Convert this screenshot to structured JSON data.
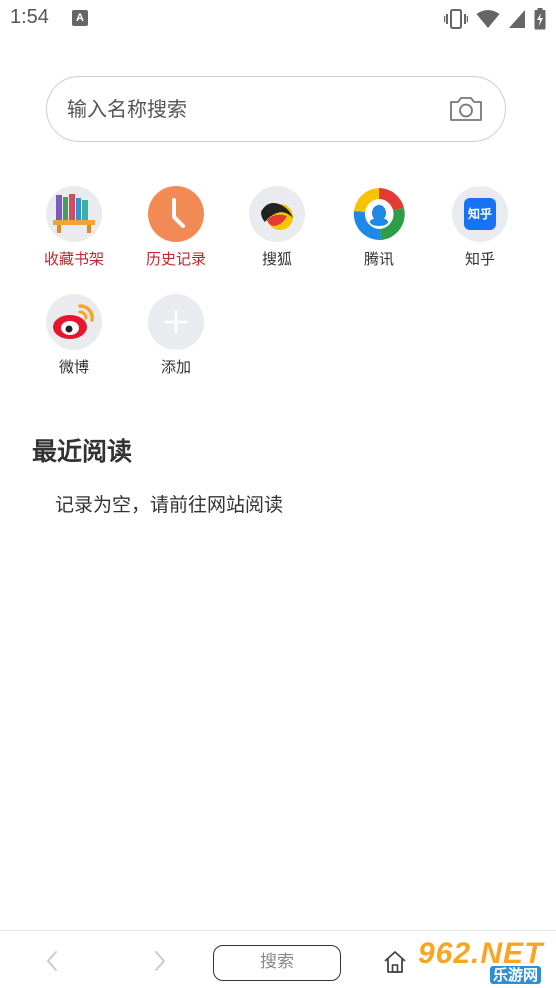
{
  "status_bar": {
    "time": "1:54",
    "notification_icon": "A",
    "icons": [
      "vibrate-icon",
      "wifi-icon",
      "signal-icon",
      "battery-charging-icon"
    ]
  },
  "search": {
    "placeholder": "输入名称搜索",
    "value": "",
    "camera_icon": "camera-icon"
  },
  "shortcuts": [
    {
      "label": "收藏书架",
      "icon": "bookshelf-icon",
      "label_color": "#c0262c"
    },
    {
      "label": "历史记录",
      "icon": "clock-icon",
      "label_color": "#c0262c",
      "bg_color": "#f28a56"
    },
    {
      "label": "搜狐",
      "icon": "sohu-icon"
    },
    {
      "label": "腾讯",
      "icon": "tencent-icon"
    },
    {
      "label": "知乎",
      "icon": "zhihu-icon",
      "badge": "知乎",
      "brand_color": "#1772f6"
    },
    {
      "label": "微博",
      "icon": "weibo-icon",
      "brand_color": "#e6162d"
    },
    {
      "label": "添加",
      "icon": "plus-icon"
    }
  ],
  "recent": {
    "title": "最近阅读",
    "empty_text": "记录为空，请前往网站阅读"
  },
  "bottom_bar": {
    "back_icon": "chevron-left-icon",
    "forward_icon": "chevron-right-icon",
    "search_label": "搜索",
    "home_icon": "home-icon"
  },
  "watermark": {
    "top": "962.NET",
    "bottom": "乐游网"
  },
  "colors": {
    "accent_red": "#c0262c",
    "history_orange": "#f28a56",
    "icon_bg": "#e9ebef"
  }
}
